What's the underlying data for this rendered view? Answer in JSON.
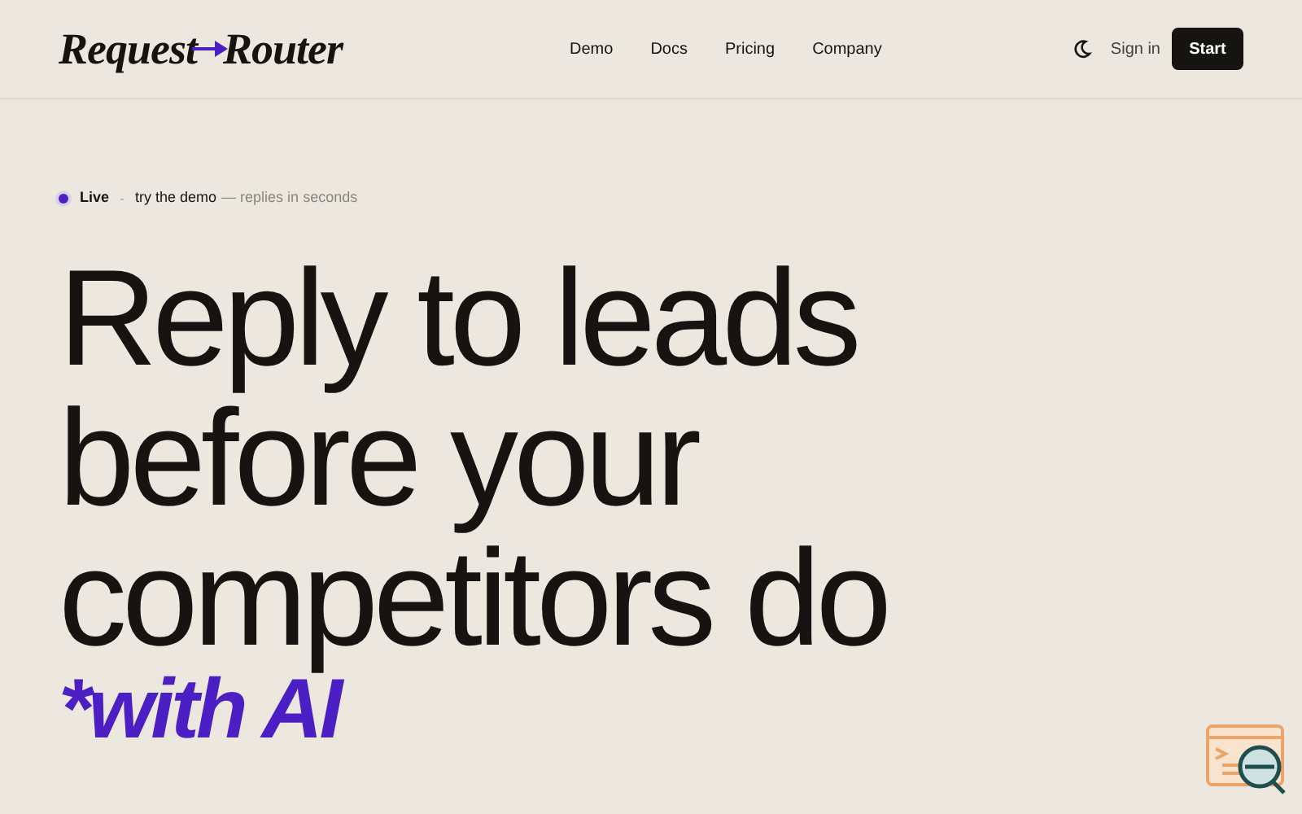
{
  "header": {
    "logo": {
      "left": "Request",
      "right": "Router"
    },
    "nav": [
      {
        "label": "Demo"
      },
      {
        "label": "Docs"
      },
      {
        "label": "Pricing"
      },
      {
        "label": "Company"
      }
    ],
    "sign_in": "Sign in",
    "cta": "Start"
  },
  "hero": {
    "badge": {
      "status": "Live",
      "link": "try the demo",
      "note": "— replies in seconds"
    },
    "headline": [
      "Reply to leads",
      "before your",
      "competitors do"
    ],
    "accent": "*with AI"
  }
}
